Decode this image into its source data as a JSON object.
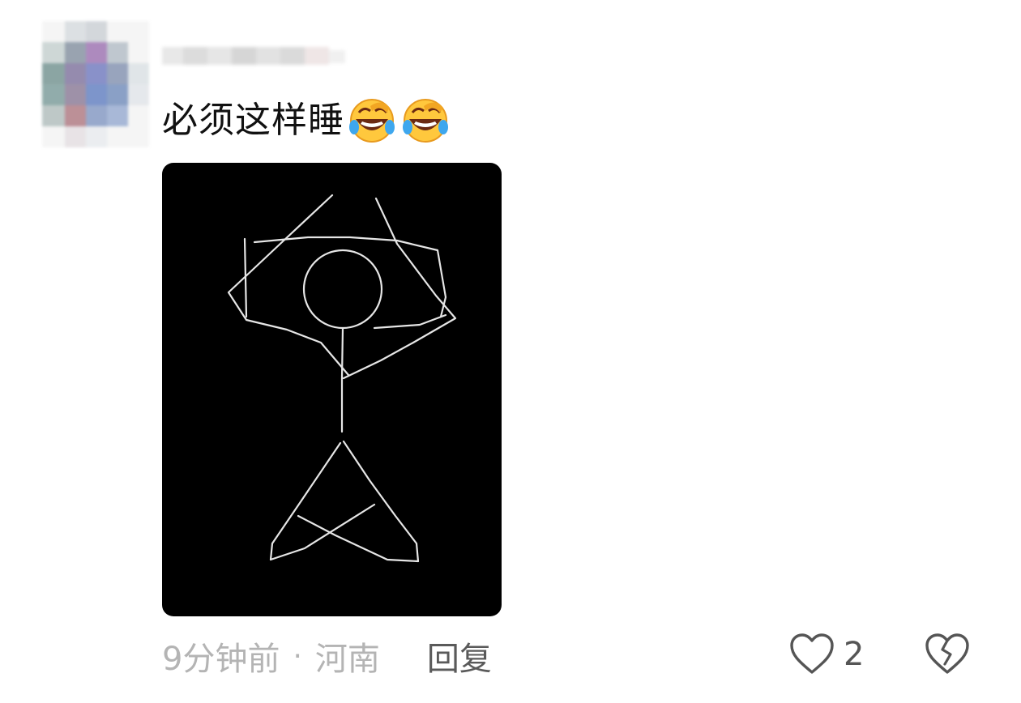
{
  "comment": {
    "text": "必须这样睡",
    "emojis": [
      "laughing-crying-emoji",
      "laughing-crying-emoji"
    ],
    "time": "9分钟前",
    "separator": "·",
    "region": "河南",
    "reply_label": "回复",
    "like_count": "2"
  },
  "icons": {
    "like": "heart-outline-icon",
    "dislike": "broken-heart-icon"
  },
  "colors": {
    "text": "#111111",
    "meta": "#b4b4b4",
    "reply": "#5a5a5a",
    "image_bg": "#000000",
    "drawing_stroke": "#e6e6e6"
  }
}
